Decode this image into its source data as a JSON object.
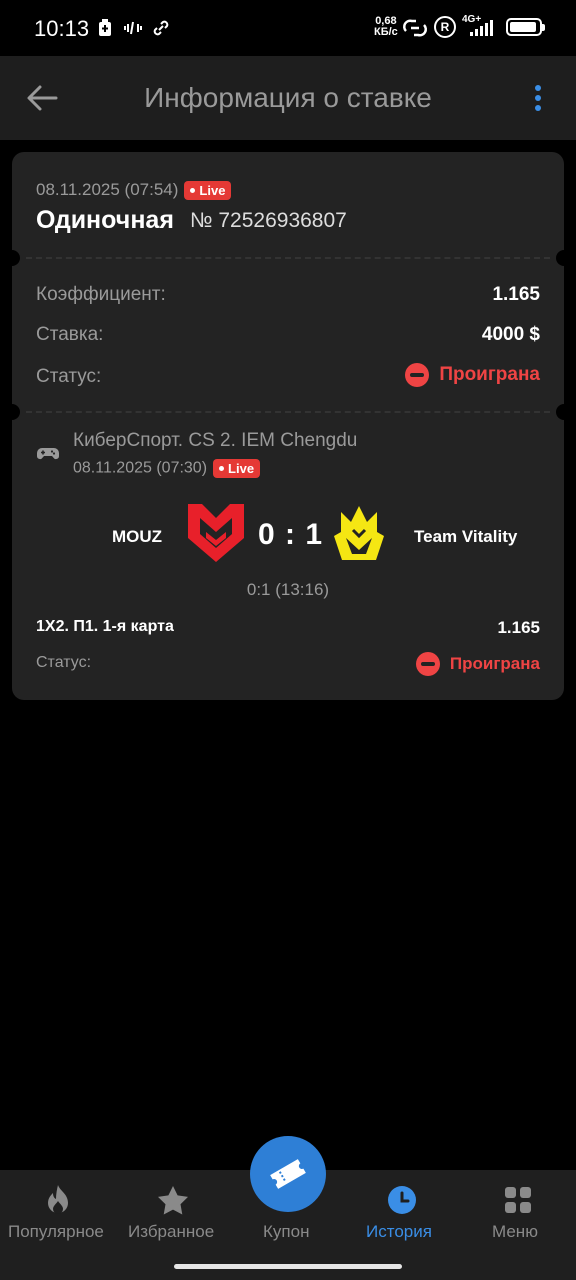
{
  "status_bar": {
    "time": "10:13",
    "net_speed_value": "0,68",
    "net_speed_unit": "КБ/с",
    "network_type": "4G+",
    "roaming_badge": "R"
  },
  "header": {
    "title": "Информация о ставке",
    "back_icon": "arrow-left-icon",
    "menu_icon": "more-vertical-icon",
    "accent_color": "#3a8ee6"
  },
  "bet": {
    "date": "08.11.2025 (07:54)",
    "live_label": "Live",
    "type": "Одиночная",
    "number": "№ 72526936807",
    "coef_label": "Коэффициент:",
    "coef_value": "1.165",
    "stake_label": "Ставка:",
    "stake_value": "4000 $",
    "status_label": "Статус:",
    "status_value": "Проиграна",
    "status_color": "#ef4444"
  },
  "event": {
    "tournament": "КиберСпорт. CS 2. IEM Chengdu",
    "date": "08.11.2025 (07:30)",
    "live_label": "Live",
    "team1": "MOUZ",
    "team2": "Team Vitality",
    "score": "0 : 1",
    "subscore": "0:1 (13:16)",
    "market": "1X2. П1. 1-я карта",
    "market_odd": "1.165",
    "status_label": "Статус:",
    "status_value": "Проиграна"
  },
  "bottom_nav": {
    "items": [
      {
        "label": "Популярное",
        "icon": "flame-icon"
      },
      {
        "label": "Избранное",
        "icon": "star-icon"
      },
      {
        "label": "Купон",
        "icon": "ticket-icon"
      },
      {
        "label": "История",
        "icon": "clock-icon",
        "active": true
      },
      {
        "label": "Меню",
        "icon": "grid-icon"
      }
    ]
  }
}
